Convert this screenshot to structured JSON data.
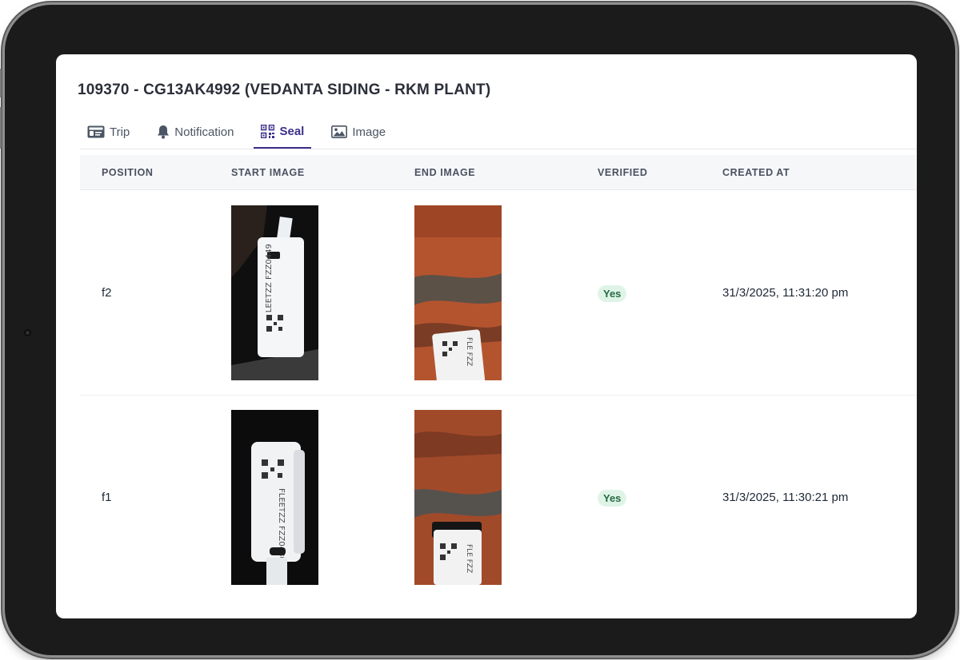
{
  "page": {
    "title": "109370 - CG13AK4992 (VEDANTA SIDING - RKM PLANT)"
  },
  "tabs": [
    {
      "label": "Trip",
      "icon": "id-card-icon",
      "active": false
    },
    {
      "label": "Notification",
      "icon": "bell-icon",
      "active": false
    },
    {
      "label": "Seal",
      "icon": "qr-code-icon",
      "active": true
    },
    {
      "label": "Image",
      "icon": "image-icon",
      "active": false
    }
  ],
  "table": {
    "columns": [
      "POSITION",
      "START IMAGE",
      "END IMAGE",
      "VERIFIED",
      "CREATED AT"
    ],
    "rows": [
      {
        "position": "f2",
        "start_image": {
          "seal_text": "FLEETZZ FZZ0449"
        },
        "end_image": {
          "seal_text": "FLE FZZ"
        },
        "verified": "Yes",
        "created_at": "31/3/2025, 11:31:20 pm"
      },
      {
        "position": "f1",
        "start_image": {
          "seal_text": "FLEETZZ FZZ0430"
        },
        "end_image": {
          "seal_text": "FLE FZZ"
        },
        "verified": "Yes",
        "created_at": "31/3/2025, 11:30:21 pm"
      }
    ]
  },
  "colors": {
    "accent": "#3b2f8a",
    "verified_bg": "#dff4e7",
    "verified_text": "#256b45",
    "header_bg": "#f6f7f9"
  }
}
